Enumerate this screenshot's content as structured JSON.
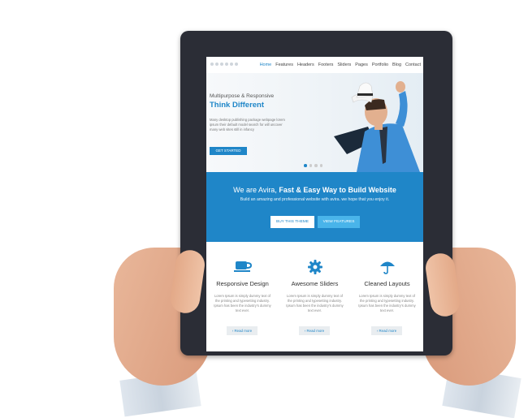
{
  "nav": {
    "items": [
      "Home",
      "Features",
      "Headers",
      "Footers",
      "Sliders",
      "Pages",
      "Portfolio",
      "Blog",
      "Contact"
    ]
  },
  "hero": {
    "subtitle": "Multipurpose & Responsive",
    "title": "Think Different",
    "text": "Many desktop publishing package webpage lorem ipsum their default model search for will uncover many web sites still in infancy",
    "button": "GET STARTED"
  },
  "band": {
    "title_prefix": "We are Avira, ",
    "title_bold": "Fast & Easy Way to Build Website",
    "subtitle": "Build an amazing and professional website with avira. we hope that you enjoy it.",
    "button_primary": "BUY THIS THEME",
    "button_secondary": "VIEW FEATURES"
  },
  "features": [
    {
      "title": "Responsive Design",
      "text": "Lorem Ipsum is simply dummy text of the printing and typesetting industry. Ipsum has been the industry's dummy text ever.",
      "button": "› Read more",
      "icon": "coffee-cup-icon"
    },
    {
      "title": "Awesome Sliders",
      "text": "Lorem Ipsum is simply dummy text of the printing and typesetting industry. Ipsum has been the industry's dummy text ever.",
      "button": "› Read more",
      "icon": "gear-icon"
    },
    {
      "title": "Cleaned Layouts",
      "text": "Lorem Ipsum is simply dummy text of the printing and typesetting industry. Ipsum has been the industry's dummy text ever.",
      "button": "› Read more",
      "icon": "umbrella-icon"
    }
  ],
  "colors": {
    "accent": "#1f86c8",
    "accent_light": "#49b4ea",
    "tablet_frame": "#2b2d36"
  }
}
